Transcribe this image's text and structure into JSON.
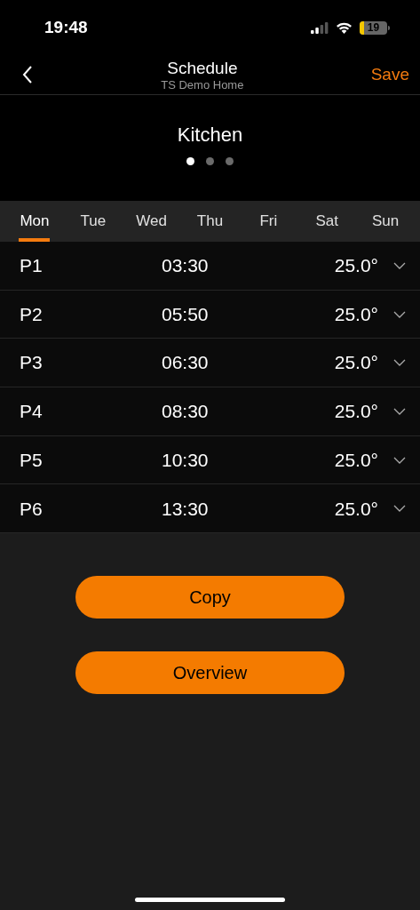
{
  "status_bar": {
    "time": "19:48",
    "battery": "19"
  },
  "header": {
    "title": "Schedule",
    "subtitle": "TS Demo Home",
    "action": "Save"
  },
  "room": {
    "name": "Kitchen",
    "pages": [
      {
        "selected": true
      },
      {
        "selected": false
      },
      {
        "selected": false
      }
    ]
  },
  "tabs": [
    {
      "label": "Mon",
      "selected": true
    },
    {
      "label": "Tue",
      "selected": false
    },
    {
      "label": "Wed",
      "selected": false
    },
    {
      "label": "Thu",
      "selected": false
    },
    {
      "label": "Fri",
      "selected": false
    },
    {
      "label": "Sat",
      "selected": false
    },
    {
      "label": "Sun",
      "selected": false
    }
  ],
  "periods": [
    {
      "name": "P1",
      "time": "03:30",
      "temperature": "25.0°"
    },
    {
      "name": "P2",
      "time": "05:50",
      "temperature": "25.0°"
    },
    {
      "name": "P3",
      "time": "06:30",
      "temperature": "25.0°"
    },
    {
      "name": "P4",
      "time": "08:30",
      "temperature": "25.0°"
    },
    {
      "name": "P5",
      "time": "10:30",
      "temperature": "25.0°"
    },
    {
      "name": "P6",
      "time": "13:30",
      "temperature": "25.0°"
    }
  ],
  "buttons": [
    "Copy",
    "Overview"
  ]
}
